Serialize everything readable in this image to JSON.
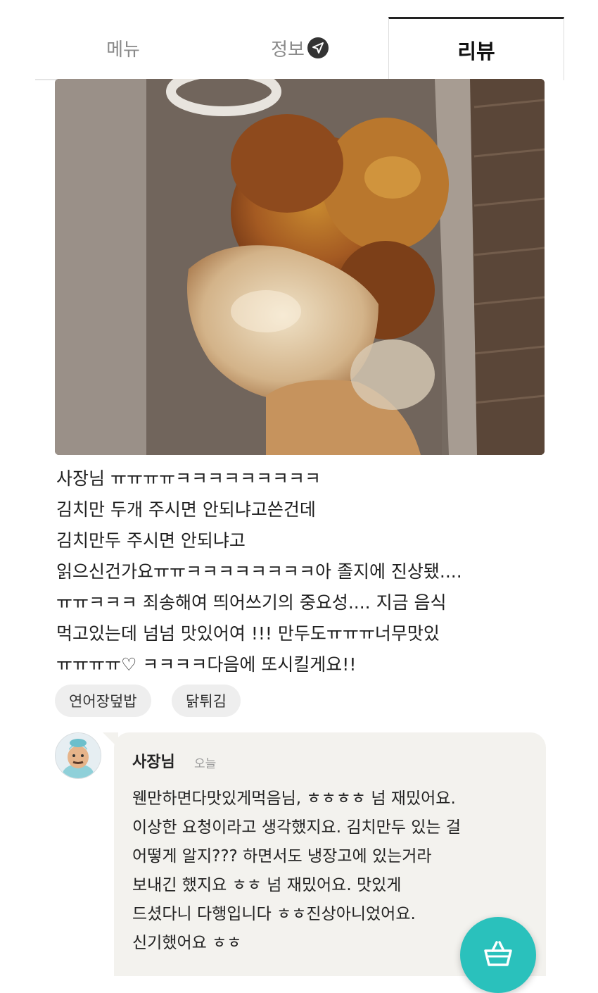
{
  "tabs": [
    {
      "label": "메뉴",
      "active": false
    },
    {
      "label": "정보",
      "active": false
    },
    {
      "label": "리뷰",
      "active": true
    }
  ],
  "review": {
    "photo": "fried-chicken-and-dumplings-photo",
    "lines": [
      "사장님 ㅠㅠㅠㅠㅋㅋㅋㅋㅋㅋㅋㅋㅋ",
      "김치만 두개 주시면 안되냐고쓴건데",
      "김치만두 주시면 안되냐고",
      "읽으신건가요ㅠㅠㅋㅋㅋㅋㅋㅋㅋㅋ아 졸지에 진상됐....",
      "ㅠㅠㅋㅋㅋ 죄송해여 띄어쓰기의 중요성.... 지금 음식",
      "먹고있는데 넘넘 맛있어여 !!! 만두도ㅠㅠㅠ너무맛있",
      "ㅠㅠㅠㅠ♡ ㅋㅋㅋㅋ다음에 또시킬게요!!"
    ],
    "menu_tags": [
      "연어장덮밥",
      "닭튀김"
    ]
  },
  "reply": {
    "author": "사장님",
    "date": "오늘",
    "lines": [
      "웬만하면다맛있게먹음님, ㅎㅎㅎㅎ 넘 재밌어요.",
      "이상한 요청이라고 생각했지요. 김치만두 있는 걸",
      "어떻게 알지??? 하면서도 냉장고에 있는거라",
      "보내긴 했지요 ㅎㅎ 넘 재밌어요. 맛있게",
      "드셨다니 다행입니다 ㅎㅎ진상아니었어요.",
      "신기했어요 ㅎㅎ"
    ]
  },
  "icons": {
    "info_tab": "send-icon",
    "avatar": "owner-avatar",
    "fab": "shopping-basket-icon"
  },
  "colors": {
    "accent": "#2ac1bc",
    "reply_background": "#f3f2ee",
    "tag_background": "#eeeeee"
  }
}
